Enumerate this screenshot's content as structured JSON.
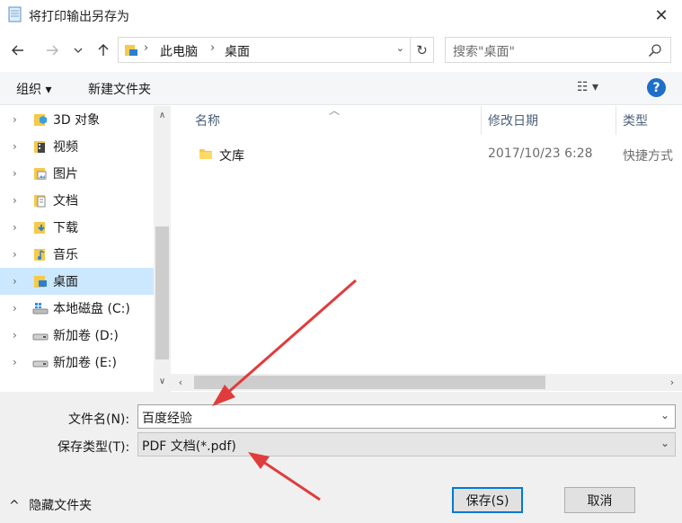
{
  "window": {
    "title": "将打印输出另存为",
    "close_label": "✕"
  },
  "nav": {
    "breadcrumb": [
      "此电脑",
      "桌面"
    ],
    "search_placeholder": "搜索\"桌面\""
  },
  "toolbar": {
    "organize_label": "组织 ▾",
    "new_folder_label": "新建文件夹",
    "view_label": "☷ ▾",
    "help_label": "?"
  },
  "sidebar": {
    "items": [
      {
        "label": "3D 对象",
        "icon": "3d-objects-icon"
      },
      {
        "label": "视频",
        "icon": "video-icon"
      },
      {
        "label": "图片",
        "icon": "pictures-icon"
      },
      {
        "label": "文档",
        "icon": "documents-icon"
      },
      {
        "label": "下载",
        "icon": "downloads-icon"
      },
      {
        "label": "音乐",
        "icon": "music-icon"
      },
      {
        "label": "桌面",
        "icon": "desktop-icon",
        "selected": true
      },
      {
        "label": "本地磁盘 (C:)",
        "icon": "windows-drive-icon"
      },
      {
        "label": "新加卷 (D:)",
        "icon": "drive-icon"
      },
      {
        "label": "新加卷 (E:)",
        "icon": "drive-icon"
      }
    ]
  },
  "files": {
    "columns": [
      "名称",
      "修改日期",
      "类型"
    ],
    "rows": [
      {
        "name": "文库",
        "modified": "2017/10/23 6:28",
        "type": "快捷方式"
      }
    ]
  },
  "form": {
    "filename_label": "文件名(N):",
    "filename_value": "百度经验",
    "savetype_label": "保存类型(T):",
    "savetype_value": "PDF 文档(*.pdf)"
  },
  "footer": {
    "hide_folders_label": "隐藏文件夹",
    "save_label": "保存(S)",
    "cancel_label": "取消"
  },
  "colors": {
    "accent": "#0078d7",
    "selection": "#cce8ff",
    "annotation_arrow": "#e03c3c"
  }
}
